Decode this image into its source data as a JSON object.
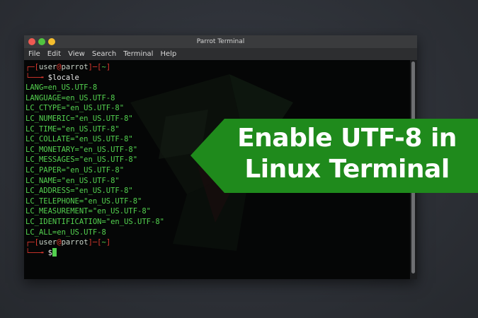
{
  "window": {
    "title": "Parrot Terminal",
    "menu": [
      "File",
      "Edit",
      "View",
      "Search",
      "Terminal",
      "Help"
    ]
  },
  "terminal": {
    "prompt1": {
      "user": "user",
      "at": "@",
      "host": "parrot",
      "dir": "~",
      "symbol": "$",
      "command": "locale"
    },
    "output": [
      "LANG=en_US.UTF-8",
      "LANGUAGE=en_US.UTF-8",
      "LC_CTYPE=\"en_US.UTF-8\"",
      "LC_NUMERIC=\"en_US.UTF-8\"",
      "LC_TIME=\"en_US.UTF-8\"",
      "LC_COLLATE=\"en_US.UTF-8\"",
      "LC_MONETARY=\"en_US.UTF-8\"",
      "LC_MESSAGES=\"en_US.UTF-8\"",
      "LC_PAPER=\"en_US.UTF-8\"",
      "LC_NAME=\"en_US.UTF-8\"",
      "LC_ADDRESS=\"en_US.UTF-8\"",
      "LC_TELEPHONE=\"en_US.UTF-8\"",
      "LC_MEASUREMENT=\"en_US.UTF-8\"",
      "LC_IDENTIFICATION=\"en_US.UTF-8\"",
      "LC_ALL=en_US.UTF-8"
    ],
    "prompt2": {
      "user": "user",
      "at": "@",
      "host": "parrot",
      "dir": "~",
      "symbol": "$"
    }
  },
  "banner": {
    "line1": "Enable UTF-8 in",
    "line2": "Linux Terminal",
    "color": "#1f8a1c"
  },
  "colors": {
    "prompt_bracket": "#e0392f",
    "text_green": "#53d14f"
  }
}
